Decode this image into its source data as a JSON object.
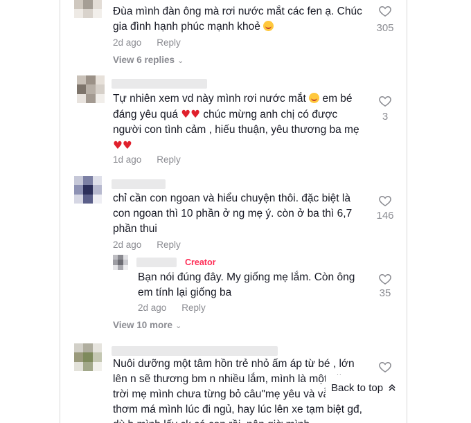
{
  "comments": [
    {
      "text": "Đùa mình đàn ông mà rơi nước mắt các fen ạ. Chúc gia đình hạnh phúc mạnh khoẻ",
      "time": "2d ago",
      "reply": "Reply",
      "likes": "305",
      "view_replies": "View 6 replies"
    },
    {
      "text": "Tự nhiên xem vd này mình rơi nước mắt",
      "text2": "em bé đáng yêu quá",
      "text3": "chúc mừng anh chị có được người con tình cảm , hiếu thuận, yêu thương ba mẹ",
      "time": "1d ago",
      "reply": "Reply",
      "likes": "3"
    },
    {
      "text": "chỉ cần con ngoan và hiểu chuyện thôi. đặc biệt là con ngoan thì 10 phần ở ng mẹ ý. còn ở ba thì 6,7 phần thui",
      "time": "2d ago",
      "reply": "Reply",
      "likes": "146",
      "view_more": "View 10 more"
    },
    {
      "text": "Nuôi dưỡng một tâm hồn trẻ nhỏ ấm áp từ bé , lớn lên n sẽ thương bm n nhiều lắm, mình là một năm trời mẹ mình chưa từng bỏ câu\"mẹ yêu và vẫn thơm má mình lúc đi ngủ, hay lúc lên xe tạm biệt gđ, dù b mình lấy ck có con rồi, nên giờ mình"
    }
  ],
  "reply": {
    "badge": "Creator",
    "text": "Bạn nói đúng đây. My giống mẹ lắm. Còn ông em tính lại giống ba",
    "time": "2d ago",
    "reply": "Reply",
    "likes": "35"
  },
  "back_to_top": "Back to top",
  "icons": {
    "like": "heart-outline-icon",
    "chevron": "chevron-down-icon",
    "up": "double-chevron-up-icon"
  }
}
